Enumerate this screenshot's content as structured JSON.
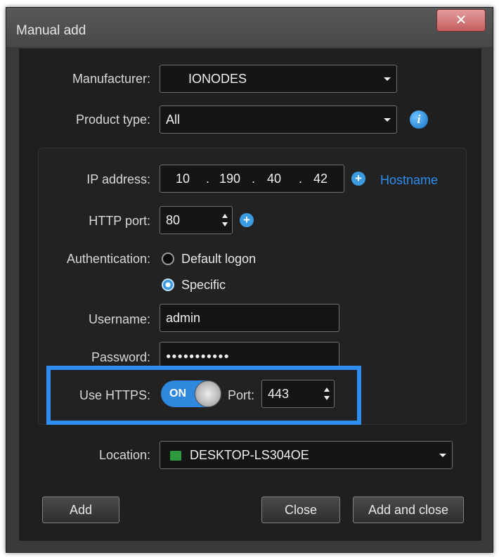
{
  "window": {
    "title": "Manual add",
    "close_glyph": "✕"
  },
  "form": {
    "manufacturer": {
      "label": "Manufacturer:",
      "value": "IONODES"
    },
    "product_type": {
      "label": "Product type:",
      "value": "All"
    },
    "ip_address": {
      "label": "IP address:",
      "octets": [
        "10",
        "190",
        "40",
        "42"
      ],
      "separator": "."
    },
    "hostname_link": "Hostname",
    "http_port": {
      "label": "HTTP port:",
      "value": "80"
    },
    "authentication": {
      "label": "Authentication:",
      "options": [
        {
          "label": "Default logon",
          "selected": false
        },
        {
          "label": "Specific",
          "selected": true
        }
      ]
    },
    "username": {
      "label": "Username:",
      "value": "admin"
    },
    "password": {
      "label": "Password:",
      "value": "●●●●●●●●●●●"
    },
    "use_https": {
      "label": "Use HTTPS:",
      "toggle_text": "ON",
      "state": true
    },
    "https_port": {
      "label": "Port:",
      "value": "443"
    },
    "location": {
      "label": "Location:",
      "value": "DESKTOP-LS304OE"
    }
  },
  "buttons": {
    "add": "Add",
    "close": "Close",
    "add_and_close": "Add and close"
  },
  "icons": {
    "info": "i",
    "plus": "+"
  },
  "colors": {
    "accent": "#2f8df0",
    "toggle_on": "#2e88dd",
    "link": "#2f8df0"
  }
}
